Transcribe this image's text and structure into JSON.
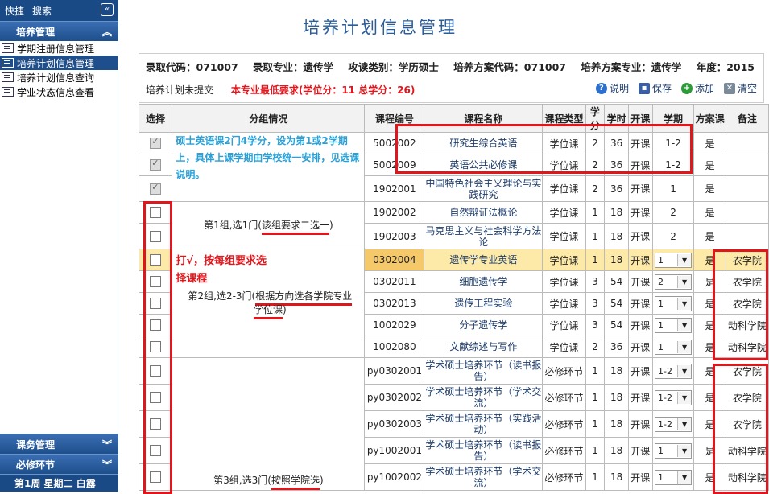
{
  "sidebar": {
    "top": {
      "shortcut": "快捷",
      "search": "搜索",
      "collapse_glyph": "«"
    },
    "section_training": "培养管理",
    "items": [
      {
        "label": "学期注册信息管理",
        "active": false
      },
      {
        "label": "培养计划信息管理",
        "active": true
      },
      {
        "label": "培养计划信息查询",
        "active": false
      },
      {
        "label": "学业状态信息查看",
        "active": false
      }
    ],
    "section_course": "课务管理",
    "section_required": "必修环节",
    "date": "第1周 星期二 白露"
  },
  "page": {
    "title": "培养计划信息管理"
  },
  "info": {
    "fields": [
      "录取代码：071007",
      "录取专业：遗传学",
      "攻读类别：学历硕士",
      "培养方案代码：071007",
      "培养方案专业：遗传学",
      "年度：2015"
    ],
    "status": "培养计划未提交",
    "requirement": "本专业最低要求(学位分：11 总学分：26)"
  },
  "actions": {
    "help": "说明",
    "save": "保存",
    "add": "添加",
    "clear": "清空"
  },
  "table": {
    "headers": [
      "选择",
      "分组情况",
      "课程编号",
      "课程名称",
      "课程类型",
      "学分",
      "学时",
      "开课",
      "学期",
      "方案课",
      "备注"
    ],
    "group_notes": {
      "blue": "硕士英语课2门4学分，设为第1或2学期上，具体上课学期由学校统一安排，见选课说明。",
      "annotation_line1": "打√，按每组要求选",
      "annotation_line2": "择课程",
      "g1_prefix": "第1组,选1门(",
      "g1_u": "该组要求二选一",
      "g1_suffix": ")",
      "g2_prefix": "第2组,选2-3门(",
      "g2_u1": "根据方向选各学院专业",
      "g2_u2": "学位课",
      "g2_suffix": ")",
      "g3_prefix": "第3组,选3门(",
      "g3_u": "按照学院选",
      "g3_suffix": ")"
    },
    "rows": [
      {
        "checked": true,
        "code": "5002002",
        "name": "研究生综合英语",
        "type": "学位课",
        "credit": "2",
        "hours": "36",
        "open": "开课",
        "term": "1-2",
        "term_select": false,
        "scheme": "是",
        "note": ""
      },
      {
        "checked": true,
        "code": "5002009",
        "name": "英语公共必修课",
        "type": "学位课",
        "credit": "2",
        "hours": "36",
        "open": "开课",
        "term": "1-2",
        "term_select": false,
        "scheme": "是",
        "note": ""
      },
      {
        "checked": true,
        "code": "1902001",
        "name": "中国特色社会主义理论与实践研究",
        "type": "学位课",
        "credit": "2",
        "hours": "36",
        "open": "开课",
        "term": "1",
        "term_select": false,
        "scheme": "是",
        "note": ""
      },
      {
        "checked": false,
        "code": "1902002",
        "name": "自然辩证法概论",
        "type": "学位课",
        "credit": "1",
        "hours": "18",
        "open": "开课",
        "term": "2",
        "term_select": false,
        "scheme": "是",
        "note": ""
      },
      {
        "checked": false,
        "code": "1902003",
        "name": "马克思主义与社会科学方法论",
        "type": "学位课",
        "credit": "1",
        "hours": "18",
        "open": "开课",
        "term": "2",
        "term_select": false,
        "scheme": "是",
        "note": ""
      },
      {
        "checked": false,
        "code": "0302004",
        "name": "遗传学专业英语",
        "type": "学位课",
        "credit": "1",
        "hours": "18",
        "open": "开课",
        "term": "1",
        "term_select": true,
        "scheme": "是",
        "note": "农学院"
      },
      {
        "checked": false,
        "code": "0302011",
        "name": "细胞遗传学",
        "type": "学位课",
        "credit": "3",
        "hours": "54",
        "open": "开课",
        "term": "2",
        "term_select": true,
        "scheme": "是",
        "note": "农学院"
      },
      {
        "checked": false,
        "code": "0302013",
        "name": "遗传工程实验",
        "type": "学位课",
        "credit": "3",
        "hours": "54",
        "open": "开课",
        "term": "1",
        "term_select": true,
        "scheme": "是",
        "note": "农学院"
      },
      {
        "checked": false,
        "code": "1002029",
        "name": "分子遗传学",
        "type": "学位课",
        "credit": "3",
        "hours": "54",
        "open": "开课",
        "term": "1",
        "term_select": true,
        "scheme": "是",
        "note": "动科学院"
      },
      {
        "checked": false,
        "code": "1002080",
        "name": "文献综述与写作",
        "type": "学位课",
        "credit": "2",
        "hours": "36",
        "open": "开课",
        "term": "1",
        "term_select": true,
        "scheme": "是",
        "note": "动科学院"
      },
      {
        "checked": false,
        "code": "py0302001",
        "name": "学术硕士培养环节（读书报告）",
        "type": "必修环节",
        "credit": "1",
        "hours": "18",
        "open": "开课",
        "term": "1-2",
        "term_select": true,
        "scheme": "是",
        "note": "农学院"
      },
      {
        "checked": false,
        "code": "py0302002",
        "name": "学术硕士培养环节（学术交流）",
        "type": "必修环节",
        "credit": "1",
        "hours": "18",
        "open": "开课",
        "term": "1-2",
        "term_select": true,
        "scheme": "是",
        "note": "农学院"
      },
      {
        "checked": false,
        "code": "py0302003",
        "name": "学术硕士培养环节（实践活动）",
        "type": "必修环节",
        "credit": "1",
        "hours": "18",
        "open": "开课",
        "term": "1-2",
        "term_select": true,
        "scheme": "是",
        "note": "农学院"
      },
      {
        "checked": false,
        "code": "py1002001",
        "name": "学术硕士培养环节（读书报告）",
        "type": "必修环节",
        "credit": "1",
        "hours": "18",
        "open": "开课",
        "term": "1",
        "term_select": true,
        "scheme": "是",
        "note": "动科学院"
      },
      {
        "checked": false,
        "code": "py1002002",
        "name": "学术硕士培养环节（学术交流）",
        "type": "必修环节",
        "credit": "1",
        "hours": "18",
        "open": "开课",
        "term": "1",
        "term_select": true,
        "scheme": "是",
        "note": "动科学院"
      }
    ]
  },
  "colors": {
    "accent": "#1e4f8c",
    "annotation_red": "#e0161c",
    "note_blue": "#29a0d6",
    "highlight_row": "#fde9a8"
  }
}
